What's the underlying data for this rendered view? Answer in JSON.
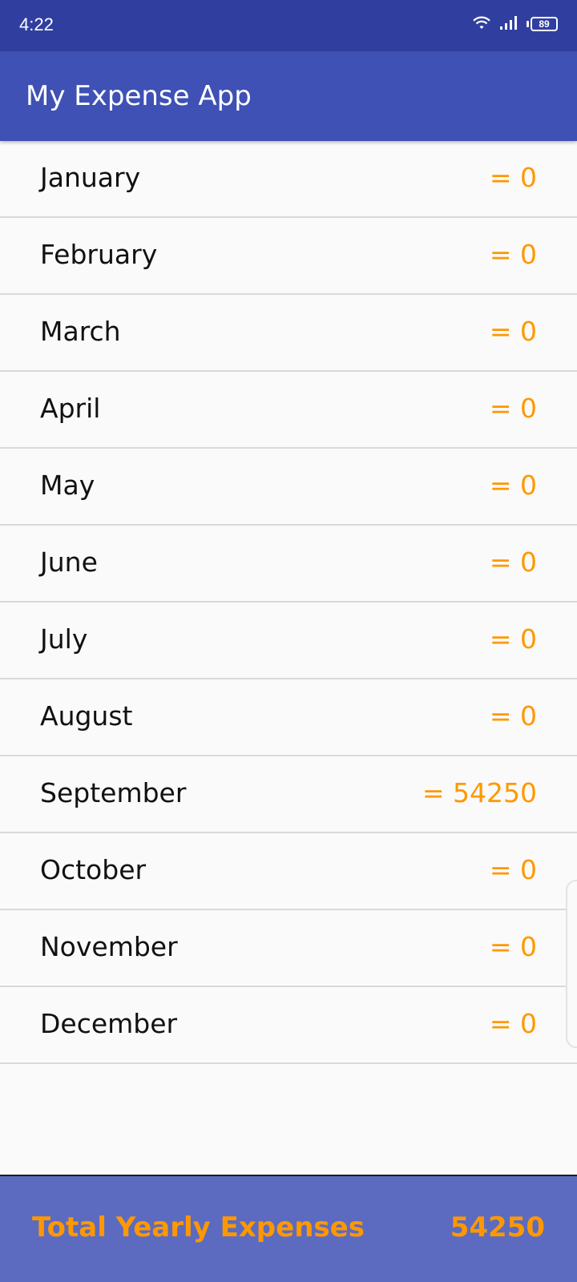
{
  "status_bar": {
    "time": "4:22",
    "battery_level": "89",
    "icons": [
      "wifi-icon",
      "signal-icon",
      "battery-icon"
    ]
  },
  "app_bar": {
    "title": "My Expense App"
  },
  "months": [
    {
      "name": "January",
      "amount": "= 0"
    },
    {
      "name": "February",
      "amount": "= 0"
    },
    {
      "name": "March",
      "amount": "= 0"
    },
    {
      "name": "April",
      "amount": "= 0"
    },
    {
      "name": "May",
      "amount": "= 0"
    },
    {
      "name": "June",
      "amount": "= 0"
    },
    {
      "name": "July",
      "amount": "= 0"
    },
    {
      "name": "August",
      "amount": "= 0"
    },
    {
      "name": "September",
      "amount": "= 54250"
    },
    {
      "name": "October",
      "amount": "= 0"
    },
    {
      "name": "November",
      "amount": "= 0"
    },
    {
      "name": "December",
      "amount": "= 0"
    }
  ],
  "footer": {
    "label": "Total Yearly Expenses",
    "total": "54250"
  },
  "colors": {
    "status_bar": "#303f9f",
    "app_bar": "#3f51b5",
    "footer": "#5c6bc0",
    "amount_accent": "#ff9800",
    "background": "#fafafa"
  }
}
